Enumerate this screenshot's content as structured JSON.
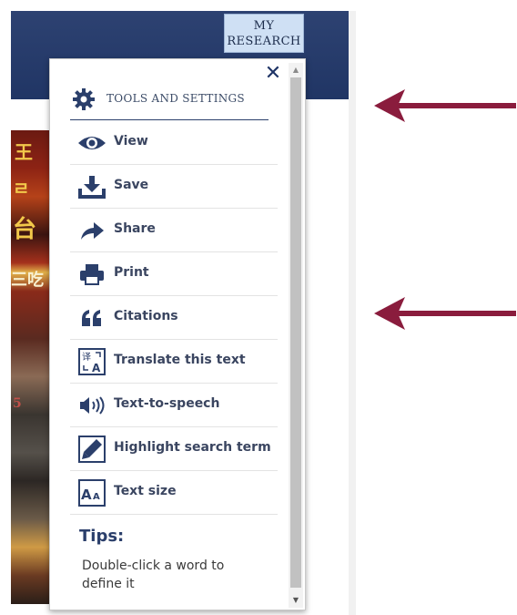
{
  "header": {
    "my_research_line1": "MY",
    "my_research_line2": "RESEARCH"
  },
  "photo": {
    "glyphs": [
      "王",
      "ㄹ",
      "台",
      "三吃",
      "5"
    ]
  },
  "panel": {
    "close_icon": "close-icon",
    "title": "TOOLS AND SETTINGS",
    "title_icon": "gear-icon",
    "items": [
      {
        "label": "View",
        "icon": "eye-icon"
      },
      {
        "label": "Save",
        "icon": "download-icon"
      },
      {
        "label": "Share",
        "icon": "share-arrow-icon"
      },
      {
        "label": "Print",
        "icon": "printer-icon"
      },
      {
        "label": "Citations",
        "icon": "quote-icon"
      },
      {
        "label": "Translate this text",
        "icon": "translate-icon"
      },
      {
        "label": "Text-to-speech",
        "icon": "speaker-icon"
      },
      {
        "label": "Highlight search term",
        "icon": "highlighter-icon"
      },
      {
        "label": "Text size",
        "icon": "text-size-icon"
      }
    ],
    "tips_title": "Tips:",
    "tips_text": "Double-click a word to define it"
  },
  "colors": {
    "header_bg": "#22386a",
    "accent": "#2b3f6b",
    "arrow": "#8a1c3d"
  }
}
